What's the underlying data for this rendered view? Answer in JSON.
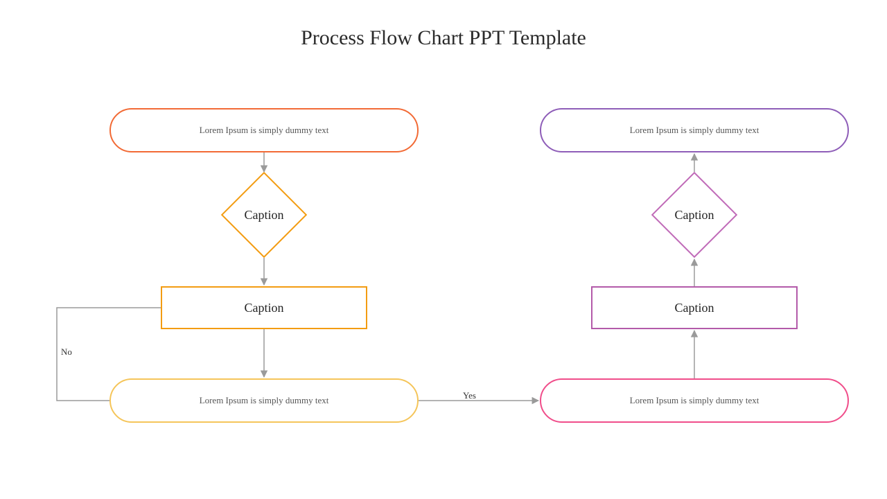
{
  "title": "Process Flow Chart PPT Template",
  "left": {
    "terminator_top": "Lorem Ipsum is simply dummy text",
    "decision": "Caption",
    "process": "Caption",
    "terminator_bottom": "Lorem Ipsum is simply dummy text"
  },
  "right": {
    "terminator_top": "Lorem Ipsum is simply dummy text",
    "decision": "Caption",
    "process": "Caption",
    "terminator_bottom": "Lorem Ipsum is simply dummy text"
  },
  "labels": {
    "no": "No",
    "yes": "Yes"
  },
  "colors": {
    "l_term_top": "#f26a35",
    "l_decision": "#f39c12",
    "l_process": "#f39c12",
    "l_term_bottom": "#f5c55a",
    "r_term_top": "#8e5db8",
    "r_decision": "#c06bb8",
    "r_process": "#b35aa9",
    "r_term_bottom": "#f04d8a",
    "arrow": "#9a9a9a"
  }
}
